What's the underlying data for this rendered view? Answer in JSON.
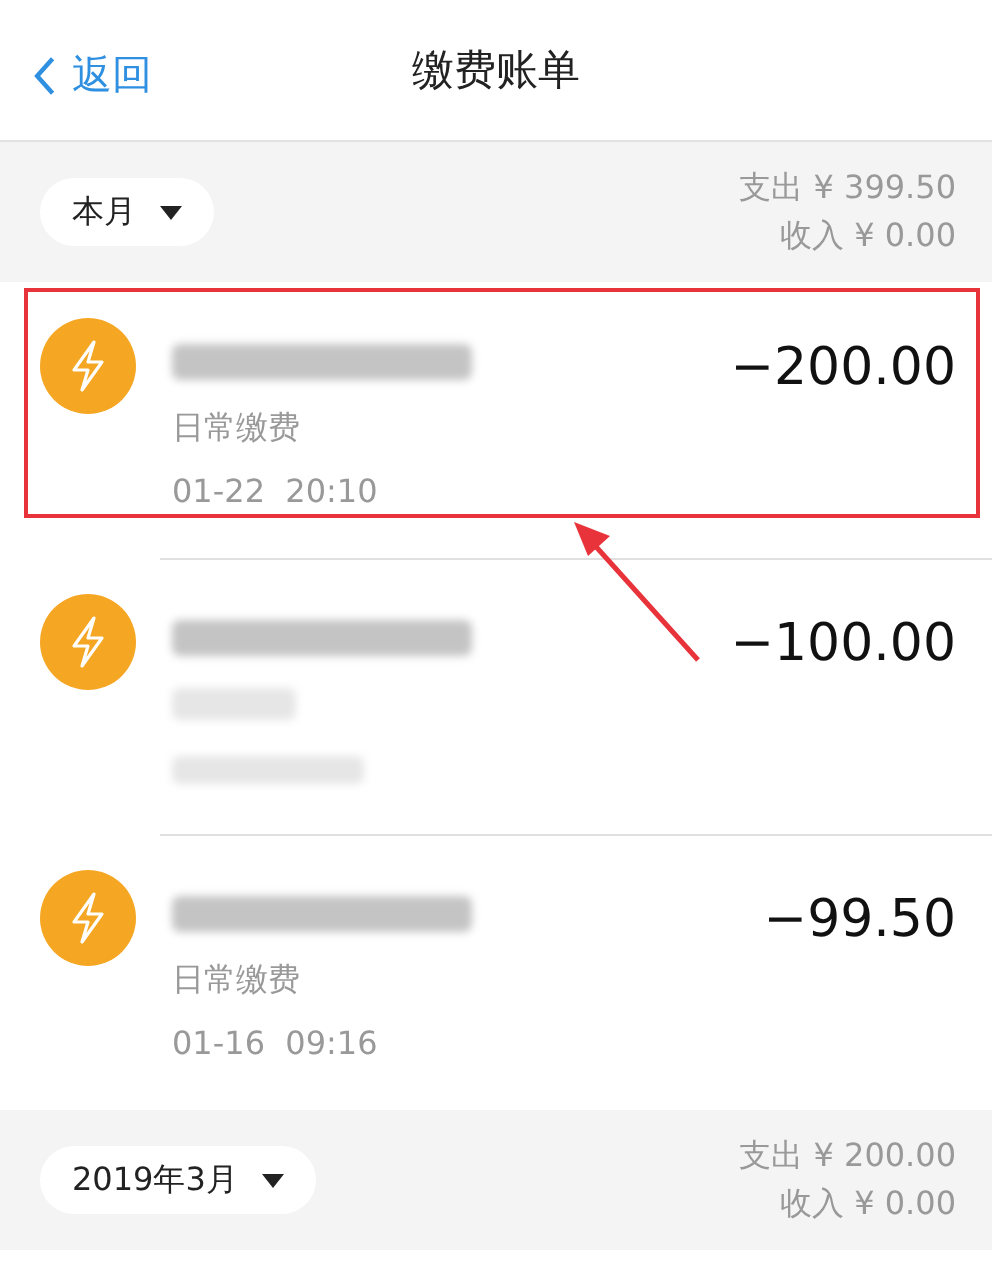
{
  "nav": {
    "back": "返回",
    "title": "缴费账单"
  },
  "sections": [
    {
      "period": "本月",
      "expense": "支出 ¥ 399.50",
      "income": "收入 ¥ 0.00",
      "rows": [
        {
          "subtitle": "日常缴费",
          "time": "01-22  20:10",
          "amount": "−200.00",
          "title_redacted": true,
          "highlighted": true
        },
        {
          "amount": "−100.00",
          "title_redacted": true,
          "details_redacted": true,
          "highlighted": false
        },
        {
          "subtitle": "日常缴费",
          "time": "01-16  09:16",
          "amount": "−99.50",
          "title_redacted": true,
          "highlighted": false
        }
      ]
    },
    {
      "period": "2019年3月",
      "expense": "支出 ¥ 200.00",
      "income": "收入 ¥ 0.00"
    }
  ]
}
